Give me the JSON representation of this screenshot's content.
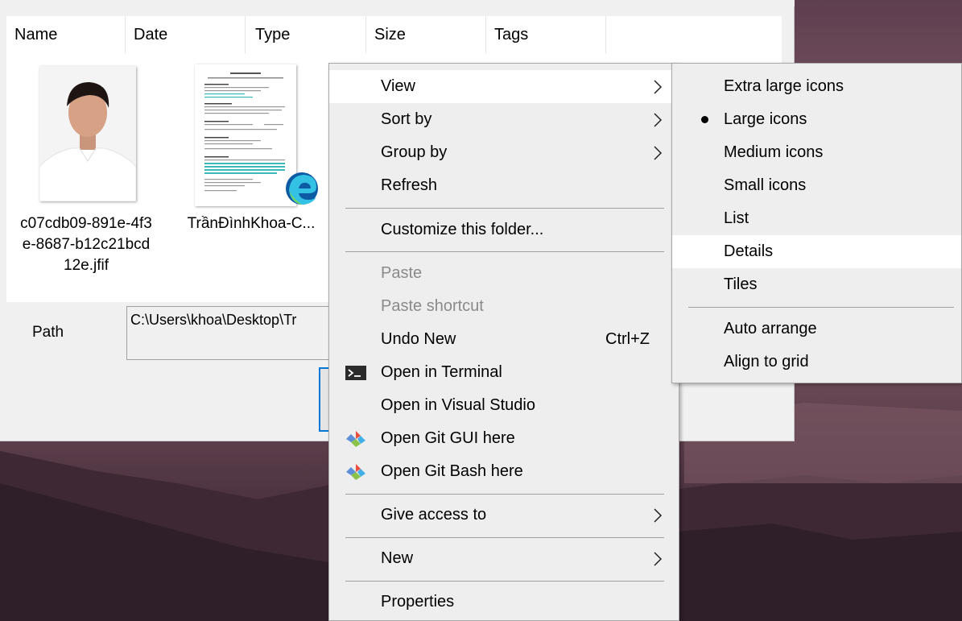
{
  "file_list": {
    "columns": [
      "Name",
      "Date",
      "Type",
      "Size",
      "Tags"
    ],
    "items": [
      {
        "name_lines": [
          "c07cdb09-891e-4f3",
          "e-8687-b12c21bcd",
          "12e.jfif"
        ],
        "thumbnail": "portrait-photo"
      },
      {
        "name_lines": [
          "TrầnĐìnhKhoa-C..."
        ],
        "thumbnail": "resume-document",
        "badge_icon": "edge-icon"
      }
    ]
  },
  "path_field": {
    "label": "Path",
    "value": "C:\\Users\\khoa\\Desktop\\Tr"
  },
  "context_menu": {
    "items": [
      {
        "label": "View",
        "has_submenu": true,
        "highlighted": true
      },
      {
        "label": "Sort by",
        "has_submenu": true
      },
      {
        "label": "Group by",
        "has_submenu": true
      },
      {
        "label": "Refresh"
      },
      {
        "separator": true
      },
      {
        "label": "Customize this folder..."
      },
      {
        "separator": true
      },
      {
        "label": "Paste",
        "disabled": true
      },
      {
        "label": "Paste shortcut",
        "disabled": true
      },
      {
        "label": "Undo New",
        "shortcut": "Ctrl+Z"
      },
      {
        "label": "Open in Terminal",
        "icon": "terminal-icon"
      },
      {
        "label": "Open in Visual Studio"
      },
      {
        "label": "Open Git GUI here",
        "icon": "git-icon"
      },
      {
        "label": "Open Git Bash here",
        "icon": "git-icon"
      },
      {
        "separator": true
      },
      {
        "label": "Give access to",
        "has_submenu": true
      },
      {
        "separator": true
      },
      {
        "label": "New",
        "has_submenu": true
      },
      {
        "separator": true
      },
      {
        "label": "Properties"
      }
    ]
  },
  "view_submenu": {
    "items": [
      {
        "label": "Extra large icons"
      },
      {
        "label": "Large icons",
        "selected": true
      },
      {
        "label": "Medium icons"
      },
      {
        "label": "Small icons"
      },
      {
        "label": "List"
      },
      {
        "label": "Details",
        "highlighted": true
      },
      {
        "label": "Tiles"
      },
      {
        "separator": true
      },
      {
        "label": "Auto arrange"
      },
      {
        "label": "Align to grid"
      }
    ]
  },
  "colors": {
    "menu_background": "#eeeeee",
    "menu_highlight": "#ffffff",
    "disabled_text": "#8a8a8a",
    "focus_accent": "#0078d7"
  }
}
